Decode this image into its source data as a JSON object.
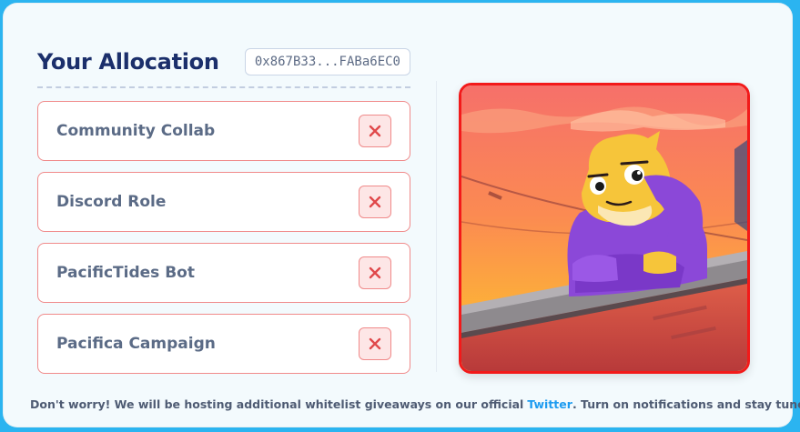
{
  "allocation": {
    "title": "Your Allocation",
    "wallet": "0x867B33...FABa6EC0"
  },
  "items": [
    {
      "label": "Community Collab",
      "status": "not-eligible"
    },
    {
      "label": "Discord Role",
      "status": "not-eligible"
    },
    {
      "label": "PacificTides Bot",
      "status": "not-eligible"
    },
    {
      "label": "Pacifica Campaign",
      "status": "not-eligible"
    }
  ],
  "footer": {
    "text_before": "Don't worry! We will be hosting additional whitelist giveaways on our official",
    "link": "Twitter",
    "text_after": ". Turn on notifications and stay tuned.",
    "icon": "wave-icon"
  },
  "colors": {
    "accent_blue": "#2bb4f0",
    "title_navy": "#1b2f6b",
    "error_red": "#f08a8a",
    "art_border": "#f21a1a",
    "link_blue": "#1d9bf0"
  }
}
